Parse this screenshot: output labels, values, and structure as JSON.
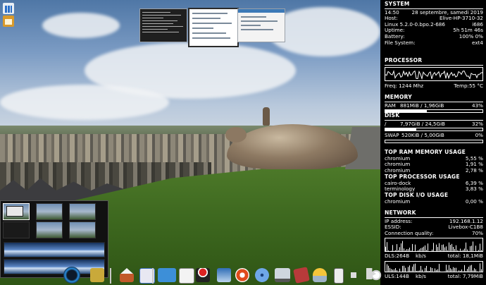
{
  "system": {
    "heading": "SYSTEM",
    "time": "14:50",
    "date": "28 septembre, samedi 2019",
    "host_label": "Host:",
    "host_value": "Elive-HP-3710-32",
    "kernel": "Linux 5.2.0-0.bpo.2-686",
    "arch": "i686",
    "uptime_label": "Uptime:",
    "uptime_value": "5h 51m 46s",
    "battery_label": "Battery:",
    "battery_value": "100% 0%",
    "fs_label": "File System:",
    "fs_value": "ext4"
  },
  "processor": {
    "heading": "PROCESSOR",
    "freq": "Freq: 1244 Mhz",
    "temp": "Temp:55 °C"
  },
  "memory": {
    "heading": "MEMORY",
    "ram_label": "RAM",
    "ram_value": "881MiB / 1,96GiB",
    "ram_percent": "43%",
    "ram_fraction": 0.43
  },
  "disk": {
    "heading": "DISK",
    "root_label": "/",
    "root_value": "7,97GiB / 24,5GiB",
    "root_percent": "32%",
    "root_fraction": 0.32,
    "swap_label": "SWAP",
    "swap_value": "520KiB / 5,00GiB",
    "swap_percent": "0%",
    "swap_fraction": 0.0
  },
  "top_ram": {
    "heading": "TOP RAM MEMORY USAGE",
    "rows": [
      {
        "name": "chromium",
        "value": "5,55 %"
      },
      {
        "name": "chromium",
        "value": "1,91 %"
      },
      {
        "name": "chromium",
        "value": "2,78 %"
      }
    ]
  },
  "top_cpu": {
    "heading": "TOP PROCESSOR USAGE",
    "rows": [
      {
        "name": "cairo-dock",
        "value": "6,39 %"
      },
      {
        "name": "terminology",
        "value": "3,83 %"
      }
    ]
  },
  "top_disk": {
    "heading": "TOP DISK I/O USAGE",
    "rows": [
      {
        "name": "chromium",
        "value": "0,00 %"
      }
    ]
  },
  "network": {
    "heading": "NETWORK",
    "ip_label": "IP address:",
    "ip_value": "192.168.1.12",
    "essid_label": "ESSID:",
    "essid_value": "Livebox-C1B8",
    "quality_label": "Connection quality:",
    "quality_value": "70%",
    "dls_label": "DLS:264B",
    "dls_unit": "kb/s",
    "dls_total": "total: 18,1MiB",
    "uls_label": "ULS:144B",
    "uls_unit": "kb/s",
    "uls_total": "total: 7,79MiB"
  },
  "icons": {
    "desktop": [
      "system-monitor-icon",
      "file-manager-icon"
    ],
    "dock": [
      "elive-logo-icon",
      "launcher-icon",
      "home-folder-icon",
      "document-icon",
      "package-box-icon",
      "text-editor-icon",
      "xmas-terminal-icon",
      "printer-icon",
      "lifebuoy-help-icon",
      "disc-icon",
      "computer-icon",
      "media-player-icon",
      "weather-icon",
      "phone-icon",
      "volume-icon",
      "brightness-icon",
      "logout-icon"
    ]
  },
  "colors": {
    "panel_bg": "#000000",
    "panel_fg": "#ffffff",
    "accent_blue": "#2a6fc9"
  }
}
